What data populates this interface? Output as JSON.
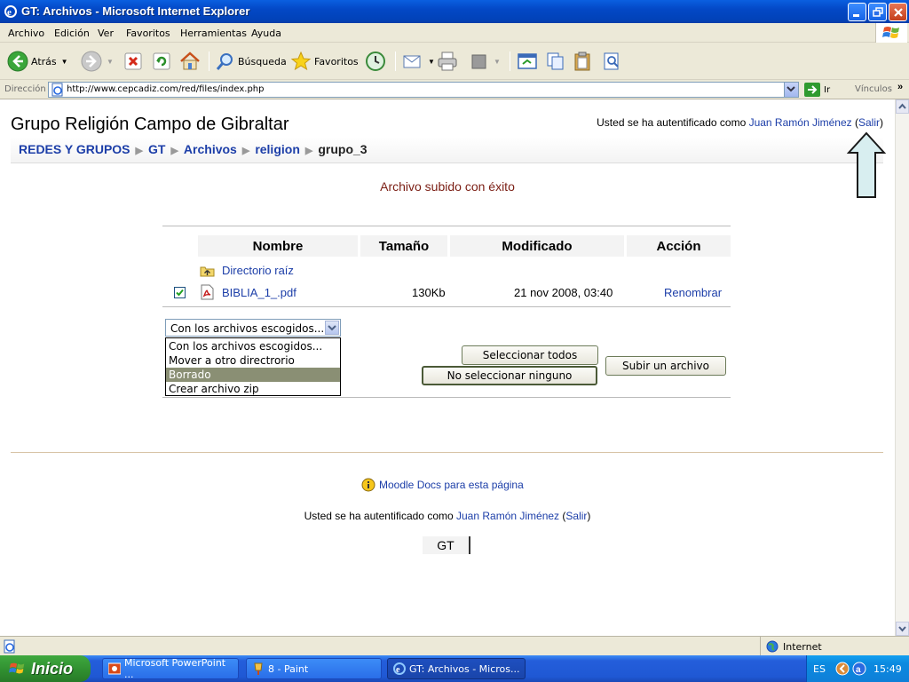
{
  "window": {
    "title": "GT: Archivos - Microsoft Internet Explorer"
  },
  "menu": {
    "items": [
      "Archivo",
      "Edición",
      "Ver",
      "Favoritos",
      "Herramientas",
      "Ayuda"
    ]
  },
  "toolbar": {
    "back_label": "Atrás",
    "search_label": "Búsqueda",
    "favorites_label": "Favoritos"
  },
  "address": {
    "label": "Dirección",
    "url": "http://www.cepcadiz.com/red/files/index.php",
    "go_label": "Ir",
    "links_label": "Vínculos"
  },
  "page": {
    "site_title": "Grupo Religión Campo de Gibraltar",
    "login_prefix": "Usted se ha autentificado como ",
    "user_name": "Juan Ramón Jiménez",
    "logout_label": "Salir",
    "breadcrumb": [
      "REDES Y GRUPOS",
      "GT",
      "Archivos",
      "religion"
    ],
    "breadcrumb_current": "grupo_3",
    "message": "Archivo subido con éxito",
    "table": {
      "headers": [
        "Nombre",
        "Tamaño",
        "Modificado",
        "Acción"
      ],
      "parent_dir": "Directorio raíz",
      "rows": [
        {
          "name": "BIBLIA_1_.pdf",
          "size": "130Kb",
          "modified": "21 nov 2008, 03:40",
          "action": "Renombrar",
          "checked": true
        }
      ]
    },
    "action_select": {
      "selected": "Con los archivos escogidos...",
      "options": [
        "Con los archivos escogidos...",
        "Mover a otro directrorio",
        "Borrado",
        "Crear archivo zip"
      ],
      "highlighted": "Borrado"
    },
    "buttons": {
      "select_all": "Seleccionar todos",
      "select_none": "No seleccionar ninguno",
      "upload": "Subir un archivo"
    },
    "docs_link": "Moodle Docs para esta página",
    "footer_course": "GT"
  },
  "statusbar": {
    "zone": "Internet"
  },
  "taskbar": {
    "start_label": "Inicio",
    "tasks": [
      "Microsoft PowerPoint ...",
      "8 - Paint",
      "GT: Archivos - Micros..."
    ],
    "lang": "ES",
    "clock": "15:49"
  }
}
